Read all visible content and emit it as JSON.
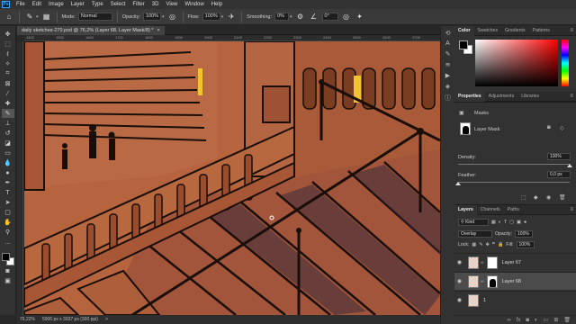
{
  "app": {
    "logo": "Ps",
    "menus": [
      "File",
      "Edit",
      "Image",
      "Layer",
      "Type",
      "Select",
      "Filter",
      "3D",
      "View",
      "Window",
      "Help"
    ]
  },
  "options": {
    "mode_label": "Mode:",
    "mode_value": "Normal",
    "opacity_label": "Opacity:",
    "opacity_value": "100%",
    "flow_label": "Flow:",
    "flow_value": "100%",
    "smoothing_label": "Smoothing:",
    "smoothing_value": "0%",
    "angle_value": "0°"
  },
  "document": {
    "tab_title": "daily sketches-270.psd @ 76,2% (Layer 68, Layer Mask/8) *",
    "close_glyph": "×",
    "ruler_numbers": [
      "1400",
      "1500",
      "1600",
      "1700",
      "1800",
      "1900",
      "2000",
      "2100",
      "2200",
      "2300",
      "2400",
      "2500",
      "2600",
      "2700"
    ]
  },
  "status": {
    "zoom": "76,22%",
    "doc_size": "5906 px x 3937 px (300 ppi)",
    "arrow": ">"
  },
  "color_panel": {
    "tabs": [
      "Color",
      "Swatches",
      "Gradients",
      "Patterns"
    ],
    "menu_icon": "≡"
  },
  "properties": {
    "tabs": [
      "Properties",
      "Adjustments",
      "Libraries"
    ],
    "menu_icon": "≡",
    "masks_label": "Masks",
    "layer_mask_label": "Layer Mask",
    "density_label": "Density:",
    "density_value": "100%",
    "feather_label": "Feather:",
    "feather_value": "0,0 px",
    "density_fraction": 1.0,
    "feather_fraction": 0.0
  },
  "layers": {
    "tabs": [
      "Layers",
      "Channels",
      "Paths"
    ],
    "menu_icon": "≡",
    "filter_kind": "Kind",
    "blend_mode": "Overlay",
    "opacity_label": "Opacity:",
    "opacity_value": "100%",
    "lock_label": "Lock:",
    "fill_label": "Fill:",
    "fill_value": "100%",
    "rows": [
      {
        "name": "Layer 67",
        "selected": false
      },
      {
        "name": "Layer 68",
        "selected": true
      },
      {
        "name": "1",
        "selected": false
      }
    ],
    "footer_icons": [
      "link-icon",
      "fx-icon",
      "mask-icon",
      "adjustment-icon",
      "group-icon",
      "new-layer-icon",
      "trash-icon"
    ]
  },
  "colors": {
    "canvas_base": "#b2603a",
    "accent_blue": "#31a8ff",
    "panel_bg": "#323232"
  }
}
